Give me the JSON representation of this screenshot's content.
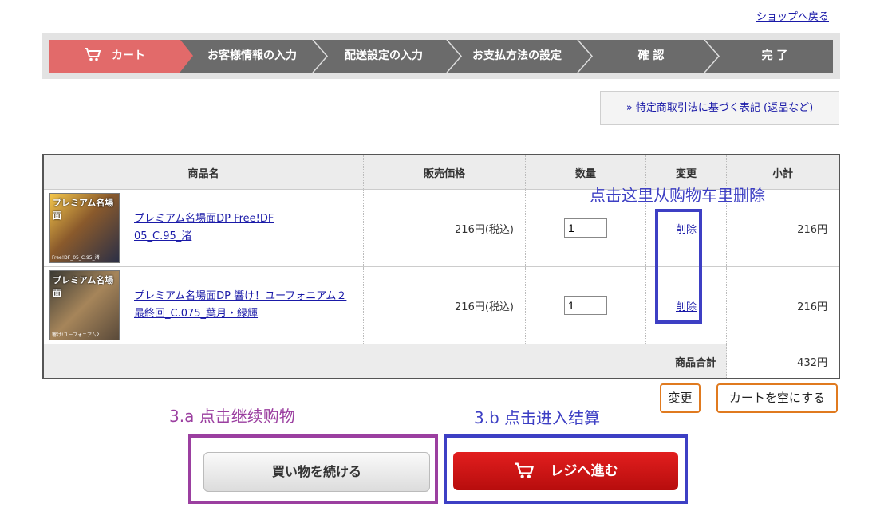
{
  "header": {
    "shop_link": "ショップへ戻る"
  },
  "steps": [
    "カート",
    "お客様情報の入力",
    "配送設定の入力",
    "お支払方法の設定",
    "確 認",
    "完 了"
  ],
  "tokutei_link": "» 特定商取引法に基づく表記 (返品など)",
  "table": {
    "headers": [
      "商品名",
      "販売価格",
      "数量",
      "変更",
      "小計"
    ],
    "rows": [
      {
        "name": "プレミアム名場面DP Free!DF 05_C.95_渚",
        "price": "216円(税込)",
        "qty": "1",
        "delete": "削除",
        "subtotal": "216円",
        "thumb_title": "プレミアム名場面",
        "thumb_sub": "Free!DF_05_C.95_渚"
      },
      {
        "name": "プレミアム名場面DP 響け！ユーフォニアム２ 最終回_C.075_葉月・緑輝",
        "price": "216円(税込)",
        "qty": "1",
        "delete": "削除",
        "subtotal": "216円",
        "thumb_title": "プレミアム名場面",
        "thumb_sub": "響け!ユーフォニアム2"
      }
    ],
    "total_label": "商品合計",
    "total_value": "432円"
  },
  "buttons": {
    "change": "変更",
    "empty_cart": "カートを空にする",
    "continue": "買い物を続ける",
    "checkout": "レジへ進む"
  },
  "annotations": {
    "delete_hint": "点击这里从购物车里删除",
    "continue_hint": "3.a 点击继续购物",
    "checkout_hint": "3.b 点击进入结算"
  },
  "colors": {
    "annotation_blue": "#3d3fc4",
    "annotation_purple": "#9b3fa0",
    "step_active": "#e26a6a",
    "checkout_red": "#d01414"
  }
}
